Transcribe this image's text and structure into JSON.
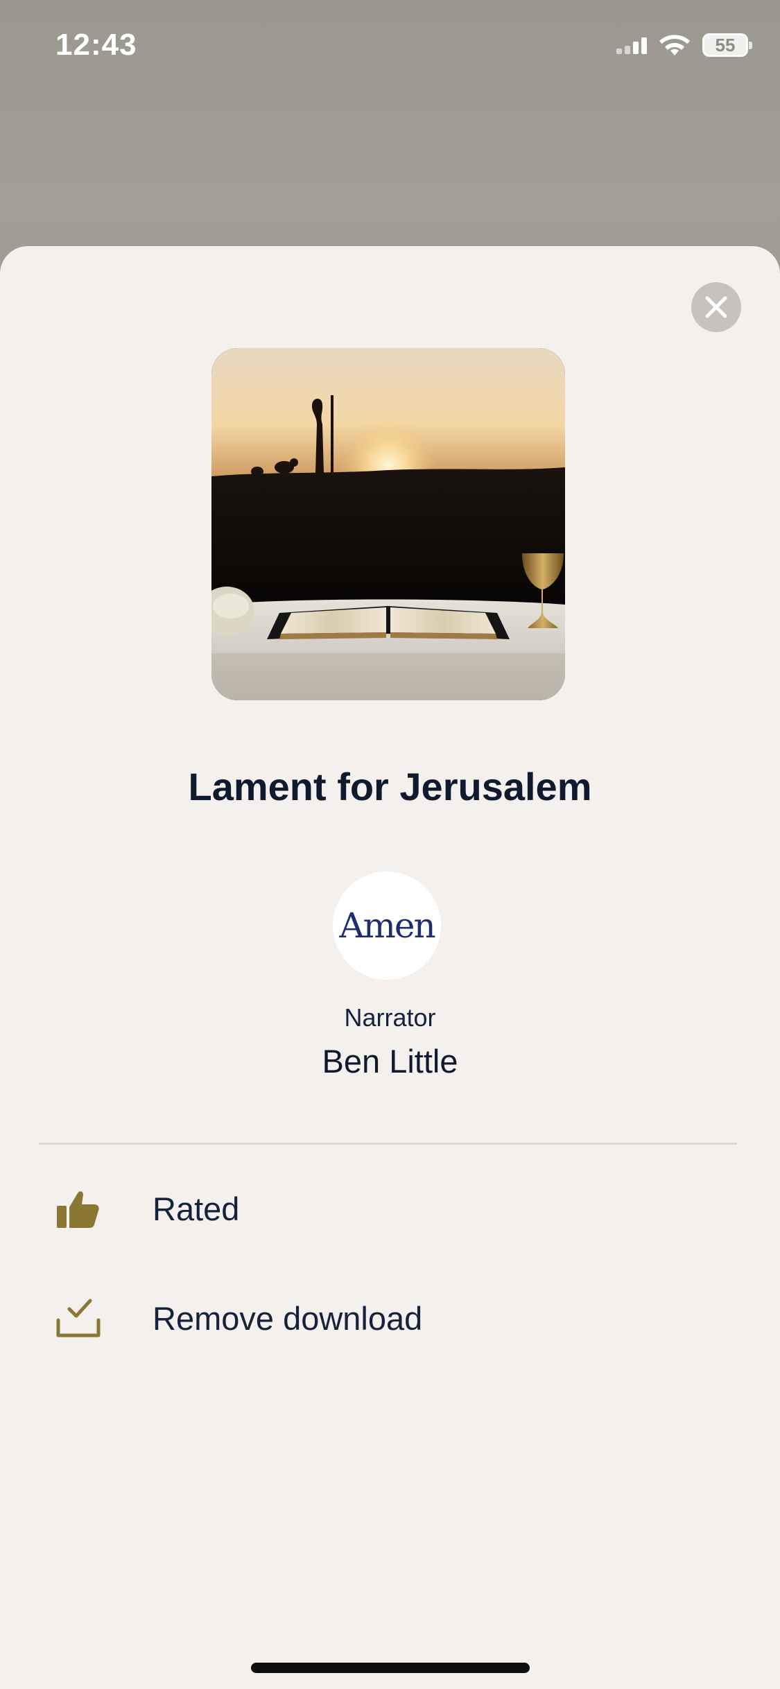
{
  "status_bar": {
    "time": "12:43",
    "battery": "55"
  },
  "episode": {
    "title": "Lament for Jerusalem",
    "artwork_alt": "Shepherd on hill at sunset with open Bible and chalice"
  },
  "publisher": {
    "logo_text": "Amen",
    "role": "Narrator",
    "name": "Ben Little"
  },
  "actions": [
    {
      "label": "Rated",
      "icon": "thumbs-up-icon"
    },
    {
      "label": "Remove download",
      "icon": "download-check-icon"
    }
  ],
  "colors": {
    "accent_gold": "#8a7733",
    "sheet_background": "#f3f0ed",
    "text_dark": "#101a2e",
    "close_button": "#c5c2c0"
  }
}
